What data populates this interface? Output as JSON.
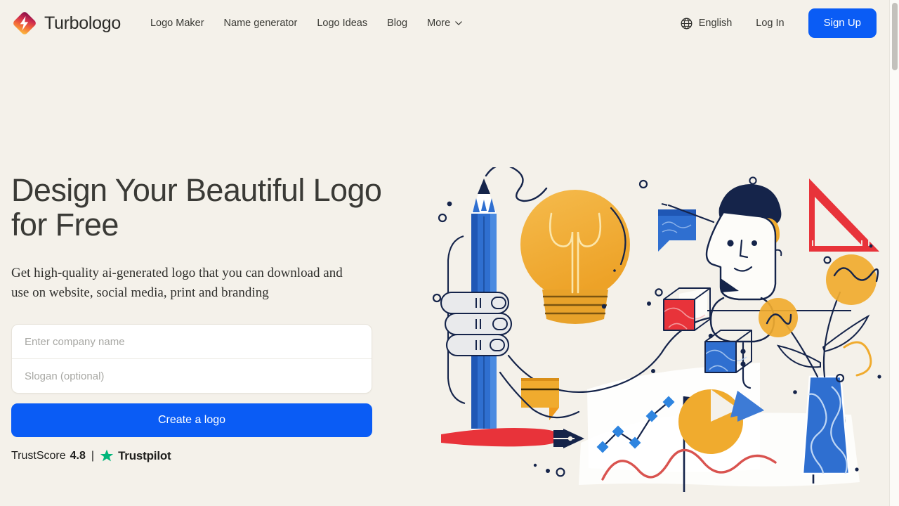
{
  "brand": {
    "name": "Turbologo",
    "mark_icon": "turbologo-diamond-icon"
  },
  "nav": {
    "items": [
      {
        "label": "Logo Maker",
        "has_chevron": false
      },
      {
        "label": "Name generator",
        "has_chevron": false
      },
      {
        "label": "Logo Ideas",
        "has_chevron": false
      },
      {
        "label": "Blog",
        "has_chevron": false
      },
      {
        "label": "More",
        "has_chevron": true
      }
    ]
  },
  "header_right": {
    "language_icon": "globe-icon",
    "language_label": "English",
    "login_label": "Log In",
    "signup_label": "Sign Up"
  },
  "hero": {
    "headline": "Design Your Beautiful Logo\nfor Free",
    "subheadline": "Get high-quality ai-generated logo that you can download and\nuse on website, social media, print and branding",
    "company_placeholder": "Enter company name",
    "company_value": "",
    "slogan_placeholder": "Slogan (optional)",
    "slogan_value": "",
    "cta_label": "Create a logo"
  },
  "trustpilot": {
    "label": "TrustScore",
    "score": "4.8",
    "separator": "|",
    "star_icon": "trustpilot-star-icon",
    "brand": "Trustpilot"
  },
  "illustration": {
    "name": "design-tools-hero-illustration",
    "elements": [
      "blue-pencil",
      "hand-holding-pencil",
      "yellow-lightbulb",
      "line-art-face",
      "red-triangle-ruler",
      "red-cube",
      "blue-cube",
      "blue-speech-bubble",
      "orange-speech-bubble",
      "red-brush-stroke",
      "navy-pen-nib",
      "white-paper-sheet",
      "blue-line-chart",
      "yellow-pie-chart",
      "blue-triangle",
      "navy-leaf-flags",
      "red-wave-line",
      "blue-vase",
      "yellow-flowers",
      "yellow-squiggle"
    ]
  },
  "colors": {
    "background": "#f4f1ea",
    "accent_blue": "#0a5cf5",
    "illustration_blue": "#2f6fd0",
    "illustration_yellow": "#f0ab2e",
    "illustration_red": "#e8333a",
    "illustration_navy": "#15244a",
    "trustpilot_green": "#00b67a",
    "text_dark": "#3a3a36"
  },
  "scrollbar": {
    "position": "right",
    "thumb_at_top": true
  }
}
